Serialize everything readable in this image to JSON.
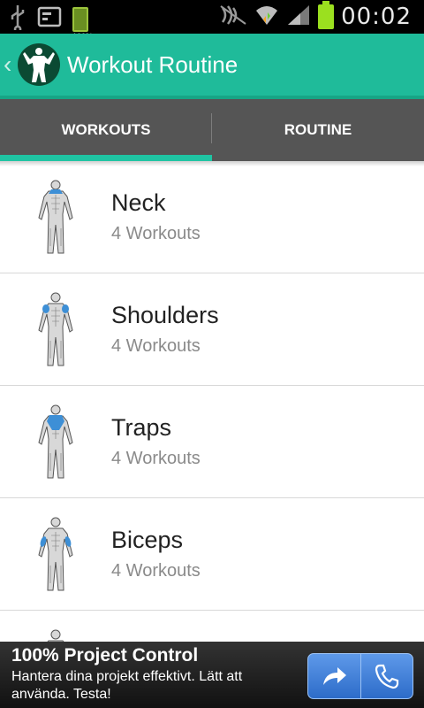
{
  "status_bar": {
    "time": "00:02",
    "battery_left_percent": "100%",
    "icons": [
      "usb-icon",
      "screenshot-icon",
      "battery-charging-icon",
      "nfc-off-icon",
      "wifi-icon",
      "signal-icon",
      "battery-icon"
    ]
  },
  "app_bar": {
    "title": "Workout Routine",
    "icon": "bodybuilder-logo"
  },
  "tabs": [
    {
      "label": "WORKOUTS",
      "active": true
    },
    {
      "label": "ROUTINE",
      "active": false
    }
  ],
  "workouts": [
    {
      "name": "Neck",
      "count": "4 Workouts",
      "highlight": "neck"
    },
    {
      "name": "Shoulders",
      "count": "4 Workouts",
      "highlight": "shoulders"
    },
    {
      "name": "Traps",
      "count": "4 Workouts",
      "highlight": "traps"
    },
    {
      "name": "Biceps",
      "count": "4 Workouts",
      "highlight": "biceps"
    }
  ],
  "ad": {
    "title": "100% Project Control",
    "text": "Hantera dina projekt effektivt. Lätt att använda. Testa!",
    "buttons": [
      "share-arrow-icon",
      "phone-icon"
    ]
  },
  "colors": {
    "accent": "#1fbb9a",
    "tab_bar": "#555555",
    "muscle_highlight": "#3d8fd6"
  }
}
